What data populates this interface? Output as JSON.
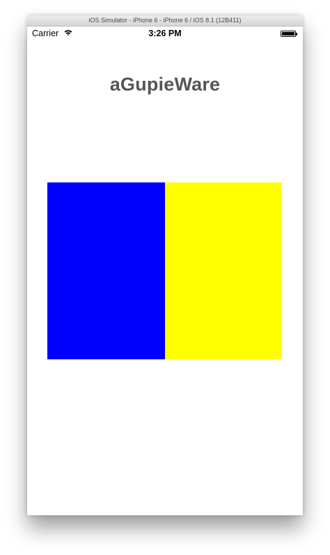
{
  "simulator": {
    "window_title": "iOS Simulator - iPhone 6 - iPhone 6 / iOS 8.1 (12B411)"
  },
  "status_bar": {
    "carrier": "Carrier",
    "time": "3:26 PM",
    "battery_level": 1.0,
    "wifi_icon": "wifi-icon",
    "battery_icon": "battery-icon"
  },
  "app": {
    "title": "aGupieWare",
    "panels": [
      {
        "color": "#0000FF"
      },
      {
        "color": "#FFFF00"
      }
    ]
  }
}
